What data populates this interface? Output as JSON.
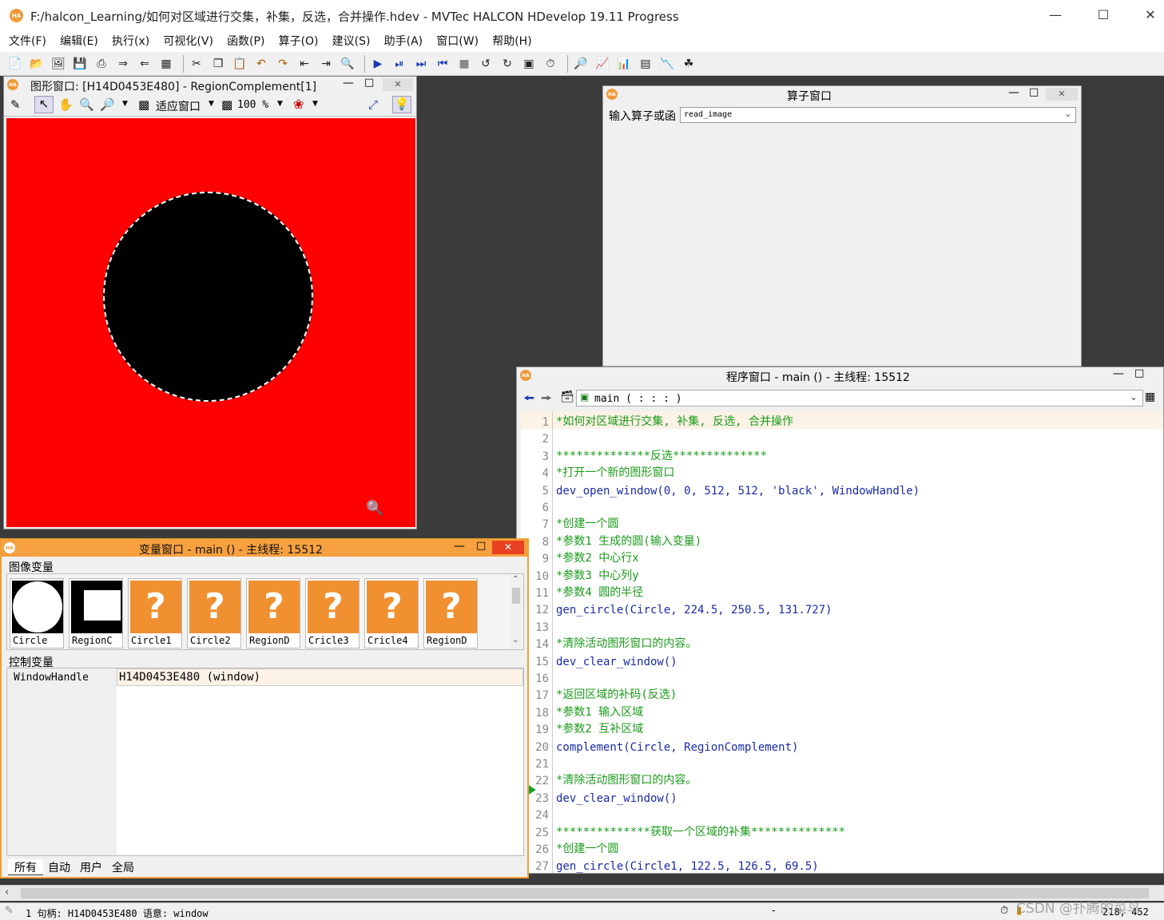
{
  "app": {
    "title": "F:/halcon_Learning/如何对区域进行交集，补集，反选，合并操作.hdev - MVTec HALCON HDevelop 19.11 Progress",
    "logo": "HA"
  },
  "menu": [
    "文件(F)",
    "编辑(E)",
    "执行(x)",
    "可视化(V)",
    "函数(P)",
    "算子(O)",
    "建议(S)",
    "助手(A)",
    "窗口(W)",
    "帮助(H)"
  ],
  "graphics_window": {
    "title": "图形窗口: [H14D0453E480] - RegionComplement[1]",
    "fit_label": "适应窗口",
    "zoom_label": "100 %"
  },
  "operator_window": {
    "title": "算子窗口",
    "input_label": "输入算子或函",
    "input_value": "read_image"
  },
  "program_window": {
    "title": "程序窗口 - main () - 主线程: 15512",
    "proc_label": "main ( : : : )",
    "lines": [
      {
        "n": "1",
        "text": "*如何对区域进行交集, 补集, 反选, 合并操作",
        "kind": "cm"
      },
      {
        "n": "2",
        "text": "",
        "kind": "cd"
      },
      {
        "n": "3",
        "text": "**************反选**************",
        "kind": "cm"
      },
      {
        "n": "4",
        "text": "*打开一个新的图形窗口",
        "kind": "cm"
      },
      {
        "n": "5",
        "text": "dev_open_window(0, 0, 512, 512, 'black', WindowHandle)",
        "kind": "cd"
      },
      {
        "n": "6",
        "text": "",
        "kind": "cd"
      },
      {
        "n": "7",
        "text": "*创建一个圆",
        "kind": "cm"
      },
      {
        "n": "8",
        "text": "*参数1 生成的圆(输入变量)",
        "kind": "cm"
      },
      {
        "n": "9",
        "text": "*参数2 中心行x",
        "kind": "cm"
      },
      {
        "n": "10",
        "text": "*参数3 中心列y",
        "kind": "cm"
      },
      {
        "n": "11",
        "text": "*参数4 圆的半径",
        "kind": "cm"
      },
      {
        "n": "12",
        "text": "gen_circle(Circle, 224.5, 250.5, 131.727)",
        "kind": "cd"
      },
      {
        "n": "13",
        "text": "",
        "kind": "cd"
      },
      {
        "n": "14",
        "text": "*清除活动图形窗口的内容。",
        "kind": "cm"
      },
      {
        "n": "15",
        "text": "dev_clear_window()",
        "kind": "cd"
      },
      {
        "n": "16",
        "text": "",
        "kind": "cd"
      },
      {
        "n": "17",
        "text": "*返回区域的补码(反选)",
        "kind": "cm"
      },
      {
        "n": "18",
        "text": "*参数1 输入区域",
        "kind": "cm"
      },
      {
        "n": "19",
        "text": "*参数2 互补区域",
        "kind": "cm"
      },
      {
        "n": "20",
        "text": "complement(Circle, RegionComplement)",
        "kind": "cd"
      },
      {
        "n": "21",
        "text": "",
        "kind": "cd"
      },
      {
        "n": "22",
        "text": "*清除活动图形窗口的内容。",
        "kind": "cm"
      },
      {
        "n": "23",
        "text": "dev_clear_window()",
        "kind": "cd"
      },
      {
        "n": "24",
        "text": "",
        "kind": "cd"
      },
      {
        "n": "25",
        "text": "**************获取一个区域的补集**************",
        "kind": "cm"
      },
      {
        "n": "26",
        "text": "*创建一个圆",
        "kind": "cm"
      },
      {
        "n": "27",
        "text": "gen_circle(Circle1, 122.5, 126.5, 69.5)",
        "kind": "cd"
      }
    ]
  },
  "variable_window": {
    "title": "变量窗口 - main () - 主线程: 15512",
    "image_vars_label": "图像变量",
    "control_vars_label": "控制变量",
    "image_vars": [
      "Circle",
      "RegionC",
      "Circle1",
      "Circle2",
      "RegionD",
      "Cricle3",
      "Cricle4",
      "RegionD"
    ],
    "control_var_name": "WindowHandle",
    "control_var_value": "H14D0453E480 (window)",
    "tabs": [
      "所有",
      "自动",
      "用户",
      "全局"
    ]
  },
  "status": {
    "text": "1  句柄: H14D0453E480 语意: window",
    "dash": "-",
    "coords": "218, 452",
    "watermark": "CSDN @扑腾的菜鸟"
  },
  "colors": {
    "accent": "#f7a040",
    "canvas": "#ff0000",
    "comment": "#1a9a1a",
    "code": "#1a2aa8"
  }
}
